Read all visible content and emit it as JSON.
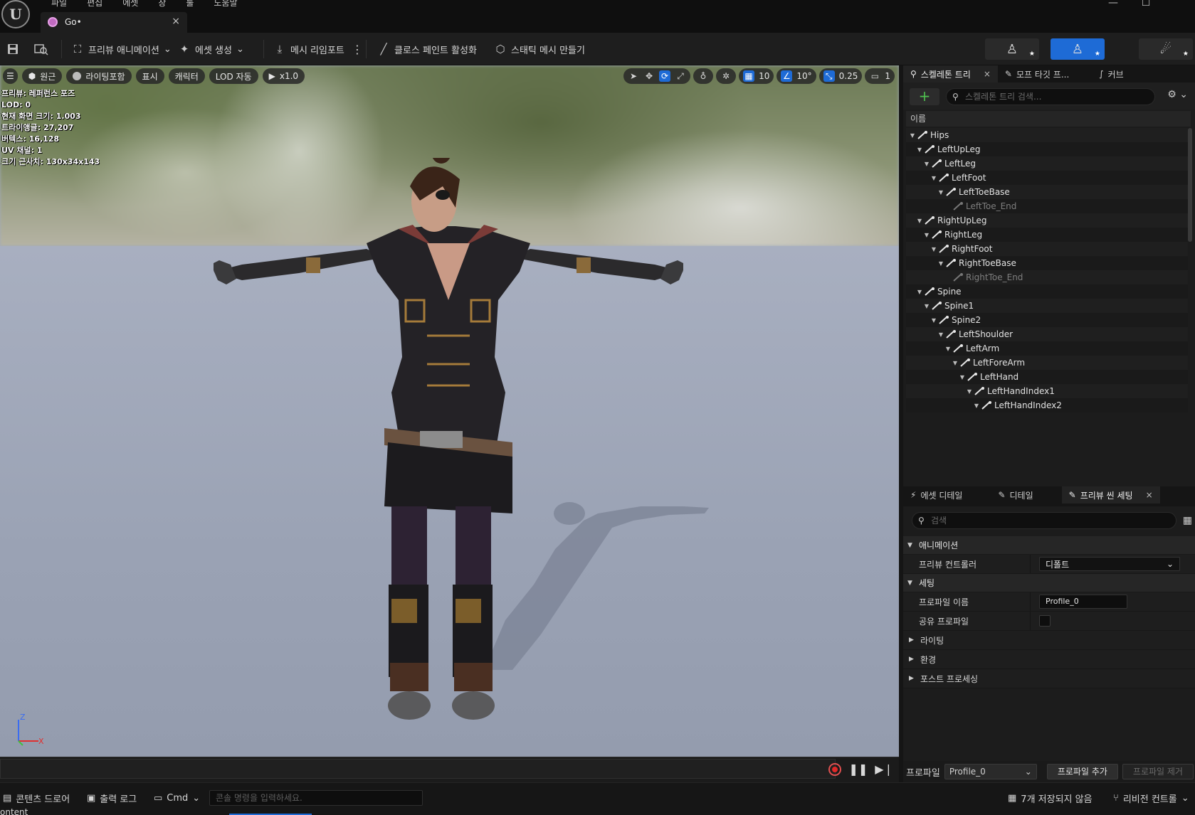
{
  "titlebar": {
    "menu": [
      "파일",
      "편집",
      "에셋",
      "창",
      "툴",
      "도움말"
    ],
    "tab_label": "Go•",
    "tab_close": "×",
    "window_controls": [
      "—",
      "☐",
      ""
    ]
  },
  "toolbar": {
    "preview_animation": "프리뷰 애니메이션",
    "create_asset": "에셋 생성",
    "mesh_reimport": "메시 리임포트",
    "cloth_paint": "클로스 페인트 활성화",
    "make_static_mesh": "스태틱 메시 만들기",
    "more": "⋮",
    "modes": [
      {
        "icon": "skeleton-mode-icon",
        "active": false
      },
      {
        "icon": "mesh-mode-icon",
        "active": true
      },
      {
        "icon": "animation-mode-icon",
        "active": false
      }
    ],
    "accent_color": "#1e6bd6"
  },
  "viewport": {
    "perspective": "원근",
    "lighting": "라이팅포함",
    "show": "표시",
    "character": "캐릭터",
    "lod": "LOD 자동",
    "play_speed": "x1.0",
    "grid_snap": "10",
    "rotation_snap": "10°",
    "scale_snap": "0.25",
    "camera_speed": "1",
    "stats": [
      "프리뷰: 레퍼런스 포즈",
      "LOD: 0",
      "현재 화면 크기: 1.003",
      "트라이앵글: 27,207",
      "버텍스: 16,128",
      "UV 채널: 1",
      "크기 근사치: 130x34x143"
    ],
    "axis": {
      "z": "Z",
      "x": "X"
    }
  },
  "skeleton_panel": {
    "tabs": [
      {
        "label": "스켈레톤 트리",
        "close": "×"
      },
      {
        "label": "모프 타깃 프..."
      },
      {
        "label": "커브"
      }
    ],
    "add_label": "+",
    "search_placeholder": "스켈레톤 트리 검색...",
    "column_header": "이름",
    "bones": [
      {
        "name": "Hips",
        "depth": 0,
        "leaf": false
      },
      {
        "name": "LeftUpLeg",
        "depth": 1,
        "leaf": false
      },
      {
        "name": "LeftLeg",
        "depth": 2,
        "leaf": false
      },
      {
        "name": "LeftFoot",
        "depth": 3,
        "leaf": false
      },
      {
        "name": "LeftToeBase",
        "depth": 4,
        "leaf": false
      },
      {
        "name": "LeftToe_End",
        "depth": 5,
        "leaf": true
      },
      {
        "name": "RightUpLeg",
        "depth": 1,
        "leaf": false
      },
      {
        "name": "RightLeg",
        "depth": 2,
        "leaf": false
      },
      {
        "name": "RightFoot",
        "depth": 3,
        "leaf": false
      },
      {
        "name": "RightToeBase",
        "depth": 4,
        "leaf": false
      },
      {
        "name": "RightToe_End",
        "depth": 5,
        "leaf": true
      },
      {
        "name": "Spine",
        "depth": 1,
        "leaf": false
      },
      {
        "name": "Spine1",
        "depth": 2,
        "leaf": false
      },
      {
        "name": "Spine2",
        "depth": 3,
        "leaf": false
      },
      {
        "name": "LeftShoulder",
        "depth": 4,
        "leaf": false
      },
      {
        "name": "LeftArm",
        "depth": 5,
        "leaf": false
      },
      {
        "name": "LeftForeArm",
        "depth": 6,
        "leaf": false
      },
      {
        "name": "LeftHand",
        "depth": 7,
        "leaf": false
      },
      {
        "name": "LeftHandIndex1",
        "depth": 8,
        "leaf": false
      },
      {
        "name": "LeftHandIndex2",
        "depth": 9,
        "leaf": false
      }
    ]
  },
  "details_panel": {
    "tabs": [
      {
        "label": "에셋 디테일"
      },
      {
        "label": "디테일"
      },
      {
        "label": "프리뷰 씬 세팅",
        "close": "×"
      }
    ],
    "search_placeholder": "검색",
    "animation_category": "애니메이션",
    "preview_controller_label": "프리뷰 컨트롤러",
    "preview_controller_value": "디폴트",
    "settings_category": "세팅",
    "profile_name_label": "프로파일 이름",
    "profile_name_value": "Profile_0",
    "shared_profile_label": "공유 프로파일",
    "lighting": "라이팅",
    "environment": "환경",
    "post_process": "포스트 프로세싱",
    "profile_bar": {
      "label": "프로파일",
      "selected": "Profile_0",
      "add": "프로파일 추가",
      "remove": "프로파일 제거"
    }
  },
  "statusbar": {
    "content_drawer": "콘텐츠 드로어",
    "output_log": "출력 로그",
    "cmd": "Cmd",
    "cmd_placeholder": "콘솔 명령을 입력하세요.",
    "unsaved": "7개 저장되지 않음",
    "revision_control": "리비전 컨트롤",
    "bottom_text": "ontent"
  }
}
